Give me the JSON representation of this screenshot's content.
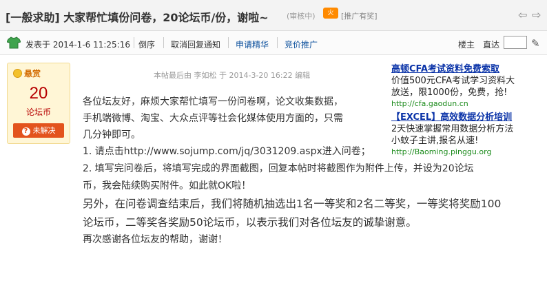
{
  "thread": {
    "title": "[一般求助] 大家帮忙填份问卷，20论坛币/份，谢啦~",
    "audit_status": "(审核中)",
    "hot_badge": "火",
    "promo_link": "[推广有奖]"
  },
  "postbar": {
    "posted_at": "发表于 2014-1-6 11:25:16",
    "links": [
      "倒序",
      "取消回复通知",
      "申请精华",
      "竞价推广"
    ],
    "owner_label": "楼主",
    "goto_label": "直达",
    "goto_value": ""
  },
  "reward": {
    "label": "悬赏",
    "amount": "20",
    "unit": "论坛币",
    "status": "未解决"
  },
  "edit_note": "本帖最后由 李如松 于 2014-3-20 16:22 编辑",
  "ad": {
    "items": [
      {
        "title": "高顿CFA考试资料免费索取",
        "desc": [
          "价值500元CFA考试学习资料大",
          "放送，限1000份，免费，抢!"
        ],
        "url": "http://cfa.gaodun.cn"
      },
      {
        "title": "【EXCEL】高效数据分析培训",
        "desc": [
          "2天快速掌握常用数据分析方法",
          "小蚊子主讲,报名从速!"
        ],
        "url": "http://Baoming.pinggu.org"
      }
    ]
  },
  "post_body": [
    "各位坛友好，麻烦大家帮忙填写一份问卷啊，论文收集数据，",
    "手机端微博、淘宝、大众点评等社会化媒体使用方面的，只需",
    "几分钟即可。",
    "1. 请点击http://www.sojump.com/jq/3031209.aspx进入问卷；",
    "2. 填写完问卷后，将填写完成的界面截图，回复本帖时将截图作为附件上传，并设为20论坛",
    "币，我会陆续购买附件。如此就OK啦！",
    "另外，在问卷调查结束后，我们将随机抽选出1名一等奖和2名二等奖，一等奖将奖励100",
    "论坛币，二等奖各奖励50论坛币，以表示我们对各位坛友的诚挚谢意。",
    "再次感谢各位坛友的帮助，谢谢！"
  ]
}
